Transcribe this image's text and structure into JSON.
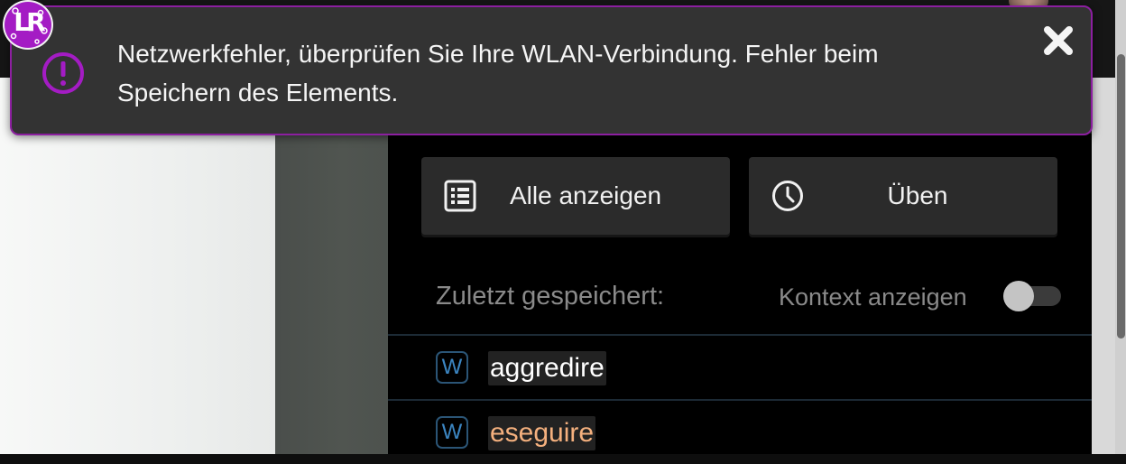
{
  "toast": {
    "message": "Netzwerkfehler, überprüfen Sie Ihre WLAN-Verbindung. Fehler beim Speichern des Elements.",
    "icon": "alert-circle-icon",
    "close_icon": "close-icon",
    "accent_color": "#a41cc4"
  },
  "logo": {
    "text": "LR"
  },
  "panel": {
    "show_all_label": "Alle anzeigen",
    "practice_label": "Üben",
    "recently_saved_label": "Zuletzt gespeichert:",
    "show_context_label": "Kontext anzeigen",
    "show_context_enabled": false
  },
  "words": [
    {
      "badge": "W",
      "text": "aggredire",
      "color": "#ffffff"
    },
    {
      "badge": "W",
      "text": "eseguire",
      "color": "#f4b07e"
    }
  ],
  "colors": {
    "word_badge_border": "#2b5576",
    "word_badge_text": "#3c86c2"
  }
}
